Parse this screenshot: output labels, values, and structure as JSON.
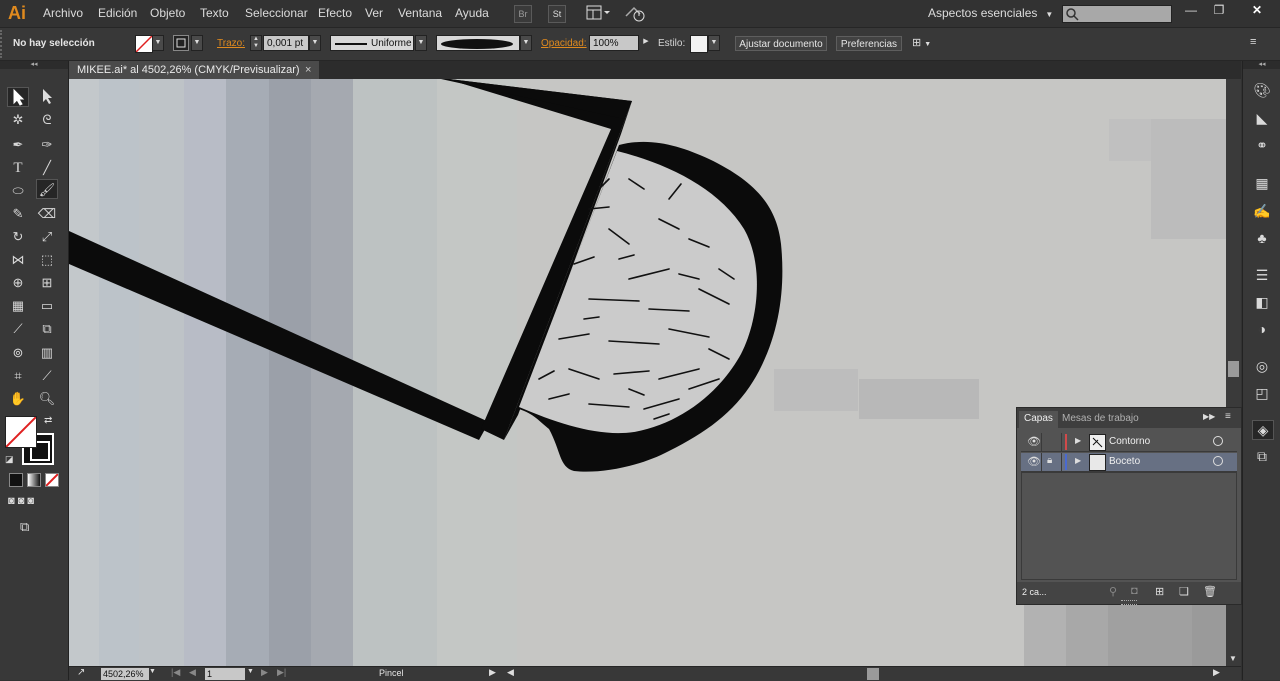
{
  "app": {
    "logo": "Ai",
    "accent": "#e08a1e"
  },
  "menu": [
    "Archivo",
    "Edición",
    "Objeto",
    "Texto",
    "Seleccionar",
    "Efecto",
    "Ver",
    "Ventana",
    "Ayuda"
  ],
  "menubar_buttons": {
    "bridge": "Br",
    "stock": "St"
  },
  "workspace": {
    "label": "Aspectos esenciales"
  },
  "control": {
    "selection": "No hay selección",
    "stroke_label": "Trazo:",
    "stroke_value": "0,001 pt",
    "profile_label": "Uniforme",
    "opacity_label": "Opacidad:",
    "opacity_value": "100%",
    "style_label": "Estilo:",
    "fit_doc": "Ajustar documento",
    "preferences": "Preferencias"
  },
  "document": {
    "tab_title": "MIKEE.ai* al 4502,26% (CMYK/Previsualizar)",
    "close": "×"
  },
  "status": {
    "zoom": "4502,26%",
    "artboard": "1",
    "tool": "Pincel"
  },
  "layers_panel": {
    "tabs": [
      "Capas",
      "Mesas de trabajo"
    ],
    "layers": [
      {
        "name": "Contorno",
        "color": "#d04a4a",
        "locked": false,
        "selected": false
      },
      {
        "name": "Boceto",
        "color": "#4a6ad0",
        "locked": true,
        "selected": true
      }
    ],
    "count": "2 ca..."
  }
}
